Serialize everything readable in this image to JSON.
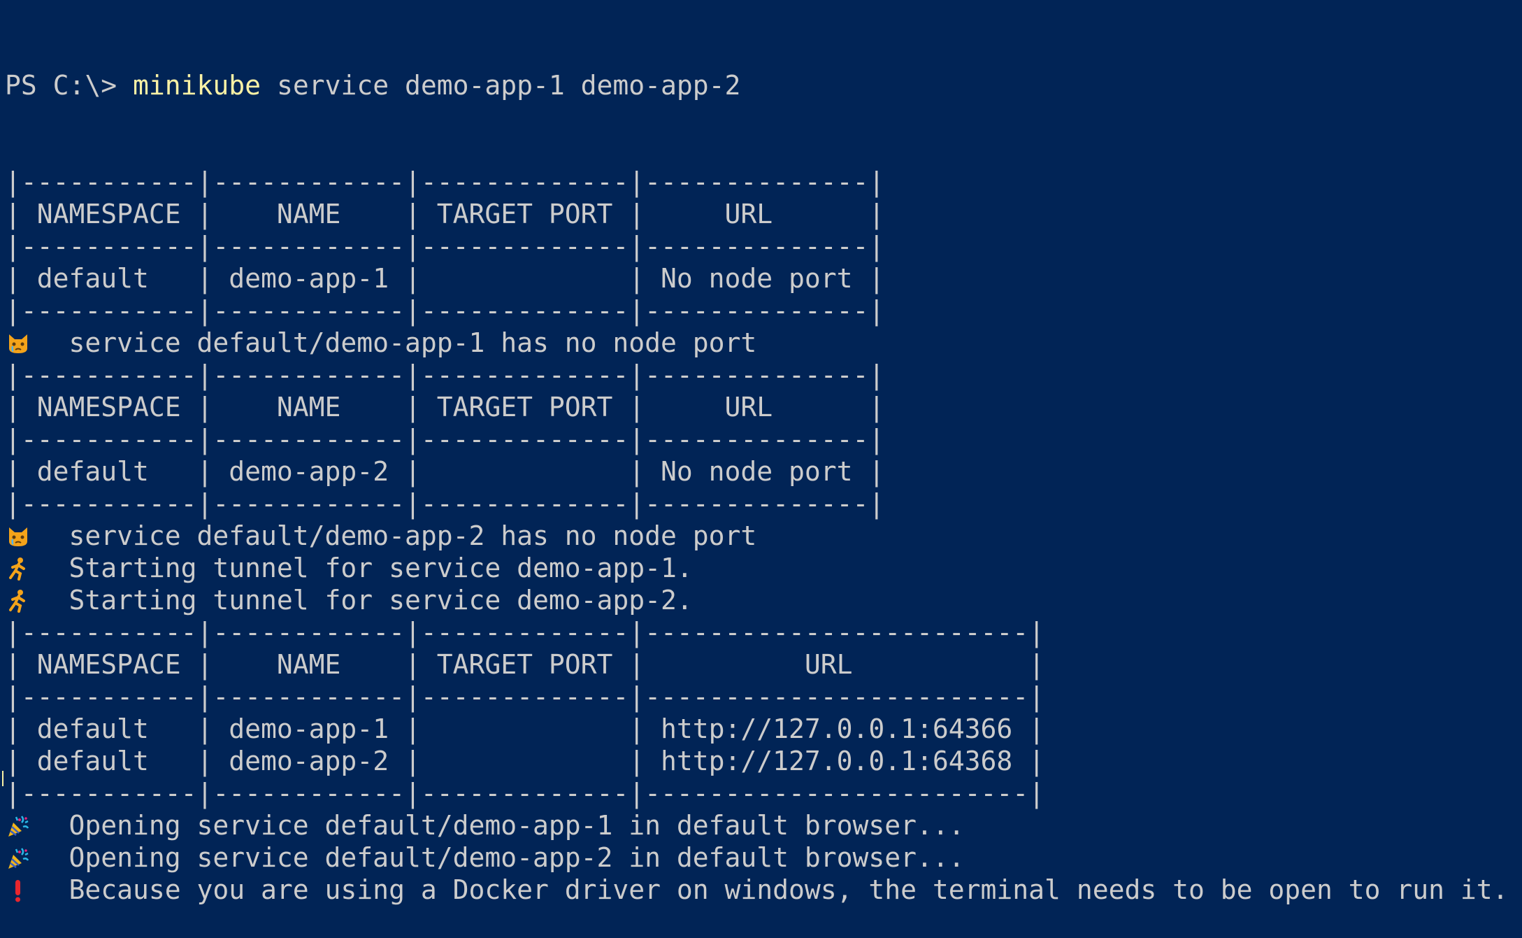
{
  "colors": {
    "background": "#012456",
    "text": "#cccccc",
    "command": "#f9f1a5",
    "warning": "#e8262d"
  },
  "prompt": {
    "prefix": "PS C:\\> ",
    "command": "minikube",
    "args": " service demo-app-1 demo-app-2"
  },
  "lines": [
    {
      "text": "|-----------|------------|-------------|--------------|"
    },
    {
      "text": "| NAMESPACE |    NAME    | TARGET PORT |     URL      |"
    },
    {
      "text": "|-----------|------------|-------------|--------------|"
    },
    {
      "text": "| default   | demo-app-1 |             | No node port |"
    },
    {
      "text": "|-----------|------------|-------------|--------------|"
    },
    {
      "icon": "crying-cat-icon",
      "text": "  service default/demo-app-1 has no node port"
    },
    {
      "text": "|-----------|------------|-------------|--------------|"
    },
    {
      "text": "| NAMESPACE |    NAME    | TARGET PORT |     URL      |"
    },
    {
      "text": "|-----------|------------|-------------|--------------|"
    },
    {
      "text": "| default   | demo-app-2 |             | No node port |"
    },
    {
      "text": "|-----------|------------|-------------|--------------|"
    },
    {
      "icon": "crying-cat-icon",
      "text": "  service default/demo-app-2 has no node port"
    },
    {
      "icon": "runner-icon",
      "text": "  Starting tunnel for service demo-app-1."
    },
    {
      "icon": "runner-icon",
      "text": "  Starting tunnel for service demo-app-2."
    },
    {
      "text": "|-----------|------------|-------------|------------------------|"
    },
    {
      "text": "| NAMESPACE |    NAME    | TARGET PORT |          URL           |"
    },
    {
      "text": "|-----------|------------|-------------|------------------------|"
    },
    {
      "text": "| default   | demo-app-1 |             | http://127.0.0.1:64366 |"
    },
    {
      "text": "| default   | demo-app-2 |             | http://127.0.0.1:64368 |"
    },
    {
      "text": "|-----------|------------|-------------|------------------------|"
    },
    {
      "icon": "party-popper-icon",
      "text": "  Opening service default/demo-app-1 in default browser..."
    },
    {
      "icon": "party-popper-icon",
      "text": "  Opening service default/demo-app-2 in default browser..."
    },
    {
      "icon": "exclamation-icon",
      "text": "  Because you are using a Docker driver on windows, the terminal needs to be open to run it."
    }
  ]
}
